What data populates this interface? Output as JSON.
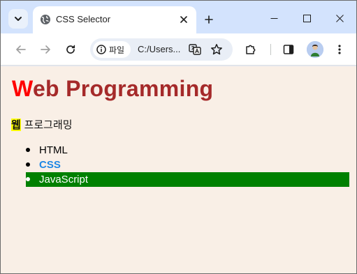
{
  "browser": {
    "tab_title": "CSS Selector",
    "site_chip_label": "파일",
    "url_text": "C:/Users...",
    "icons": {
      "tab_search": "chevron-down-icon",
      "favicon": "globe-icon",
      "tab_close": "close-icon",
      "new_tab": "plus-icon",
      "minimize": "minimize-icon",
      "maximize": "maximize-icon",
      "close_window": "close-icon",
      "back": "back-arrow-icon",
      "forward": "forward-arrow-icon",
      "reload": "reload-icon",
      "site_info": "info-icon",
      "translate": "translate-icon",
      "bookmark": "star-icon",
      "extensions": "puzzle-icon",
      "side_panel": "side-panel-icon",
      "menu": "kebab-menu-icon"
    }
  },
  "page": {
    "heading_first_letter": "W",
    "heading_rest": "eb Programming",
    "subtitle_first_char": "웹",
    "subtitle_rest": " 프로그래밍",
    "list_items": [
      "HTML",
      "CSS",
      "JavaScript"
    ],
    "colors": {
      "background": "#f9efe6",
      "heading": "#a52a2a",
      "heading_first_letter": "#ff0000",
      "first_char_highlight": "#ffff00",
      "css_item": "#1e88e5",
      "js_item_bg": "#008000",
      "js_item_text": "#ffffff"
    }
  }
}
